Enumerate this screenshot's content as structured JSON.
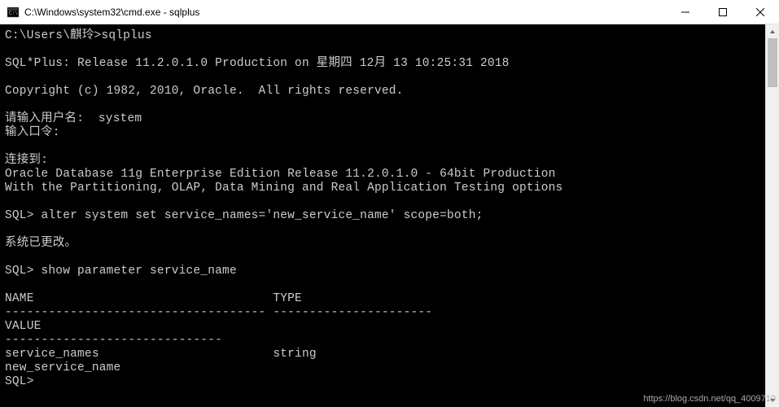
{
  "window": {
    "title": "C:\\Windows\\system32\\cmd.exe - sqlplus"
  },
  "terminal": {
    "lines": [
      "C:\\Users\\麒玲>sqlplus",
      "",
      "SQL*Plus: Release 11.2.0.1.0 Production on 星期四 12月 13 10:25:31 2018",
      "",
      "Copyright (c) 1982, 2010, Oracle.  All rights reserved.",
      "",
      "请输入用户名:  system",
      "输入口令:",
      "",
      "连接到:",
      "Oracle Database 11g Enterprise Edition Release 11.2.0.1.0 - 64bit Production",
      "With the Partitioning, OLAP, Data Mining and Real Application Testing options",
      "",
      "SQL> alter system set service_names='new_service_name' scope=both;",
      "",
      "系统已更改。",
      "",
      "SQL> show parameter service_name",
      "",
      "NAME                                 TYPE",
      "------------------------------------ ----------------------",
      "VALUE",
      "------------------------------",
      "service_names                        string",
      "new_service_name",
      "SQL>"
    ]
  },
  "watermark": {
    "text": "https://blog.csdn.net/qq_4009710"
  }
}
